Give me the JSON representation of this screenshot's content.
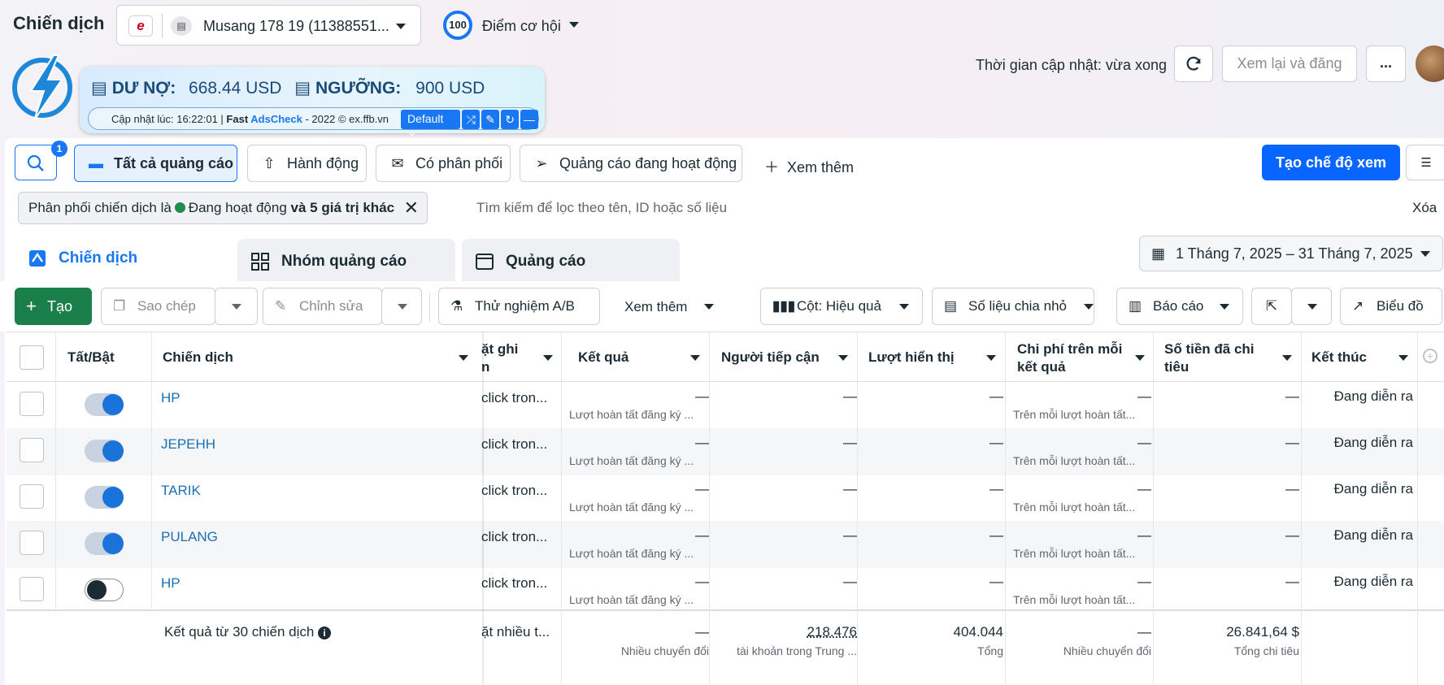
{
  "header": {
    "title": "Chiến dịch",
    "account_name": "Musang 178 19 (11388551...",
    "score": "100",
    "score_label": "Điểm cơ hội",
    "update_time": "Thời gian cập nhật: vừa xong",
    "review_button": "Xem lại và đăng",
    "more_button": "..."
  },
  "ext_panel": {
    "debt_label": "DƯ NỢ:",
    "debt_value": "668.44 USD",
    "limit_label": "NGƯỠNG:",
    "limit_value": "900 USD",
    "update_prefix": "Cập nhật lúc: 16:22:01 | ",
    "brand_fast": "Fast ",
    "brand_ads": "AdsCheck",
    "update_suffix": " - 2022 © ex.ffb.vn",
    "preset": "Default"
  },
  "filters": {
    "search_badge": "1",
    "all_ads": "Tất cả quảng cáo",
    "actions": "Hành động",
    "delivered": "Có phân phối",
    "active_ads": "Quảng cáo đang hoạt động",
    "see_more": "Xem thêm",
    "create_view": "Tạo chế độ xem",
    "chip_prefix": "Phân phối chiến dịch là",
    "chip_status": "Đang hoạt động",
    "chip_suffix": "và 5 giá trị khác",
    "search_placeholder": "Tìm kiếm để lọc theo tên, ID hoặc số liệu",
    "clear": "Xóa"
  },
  "tabs": {
    "campaigns": "Chiến dịch",
    "adsets": "Nhóm quảng cáo",
    "ads": "Quảng cáo",
    "date_range": "1 Tháng 7, 2025 – 31 Tháng 7, 2025"
  },
  "toolbar": {
    "create": "Tạo",
    "duplicate": "Sao chép",
    "edit": "Chỉnh sửa",
    "ab_test": "Thử nghiệm A/B",
    "more": "Xem thêm",
    "columns": "Cột: Hiệu quả",
    "breakdown": "Số liệu chia nhỏ",
    "reports": "Báo cáo",
    "chart": "Biểu đồ"
  },
  "table": {
    "headers": {
      "toggle": "Tất/Bật",
      "campaign": "Chiến dịch",
      "attribution_1": "ặt ghi",
      "attribution_2": "n",
      "results": "Kết quả",
      "reach": "Người tiếp cận",
      "impressions": "Lượt hiển thị",
      "cpr_1": "Chi phí trên mỗi",
      "cpr_2": "kết quả",
      "spend_1": "Số tiền đã chi",
      "spend_2": "tiêu",
      "ends": "Kết thúc"
    },
    "rows": [
      {
        "name": "HP",
        "on": true,
        "attr": "click tron...",
        "result": "—",
        "result_sub": "Lượt hoàn tất đăng ký ...",
        "reach": "—",
        "impr": "—",
        "cpr": "—",
        "cpr_sub": "Trên mỗi lượt hoàn tất...",
        "spend": "—",
        "ends": "Đang diễn ra"
      },
      {
        "name": "JEPEHH",
        "on": true,
        "attr": "click tron...",
        "result": "—",
        "result_sub": "Lượt hoàn tất đăng ký ...",
        "reach": "—",
        "impr": "—",
        "cpr": "—",
        "cpr_sub": "Trên mỗi lượt hoàn tất...",
        "spend": "—",
        "ends": "Đang diễn ra"
      },
      {
        "name": "TARIK",
        "on": true,
        "attr": "click tron...",
        "result": "—",
        "result_sub": "Lượt hoàn tất đăng ký ...",
        "reach": "—",
        "impr": "—",
        "cpr": "—",
        "cpr_sub": "Trên mỗi lượt hoàn tất...",
        "spend": "—",
        "ends": "Đang diễn ra"
      },
      {
        "name": "PULANG",
        "on": true,
        "attr": "click tron...",
        "result": "—",
        "result_sub": "Lượt hoàn tất đăng ký ...",
        "reach": "—",
        "impr": "—",
        "cpr": "—",
        "cpr_sub": "Trên mỗi lượt hoàn tất...",
        "spend": "—",
        "ends": "Đang diễn ra"
      },
      {
        "name": "HP",
        "on": false,
        "attr": "click tron...",
        "result": "—",
        "result_sub": "Lượt hoàn tất đăng ký ...",
        "reach": "—",
        "impr": "—",
        "cpr": "—",
        "cpr_sub": "Trên mỗi lượt hoàn tất...",
        "spend": "—",
        "ends": "Đang diễn ra"
      }
    ],
    "totals": {
      "label": "Kết quả từ 30 chiến dịch",
      "attr": "ặt nhiều t...",
      "result": "—",
      "result_sub": "Nhiều chuyển đổi",
      "reach": "218.476",
      "reach_sub": "tài khoản trong Trung ...",
      "impr": "404.044",
      "impr_sub": "Tổng",
      "cpr": "—",
      "cpr_sub": "Nhiều chuyển đổi",
      "spend": "26.841,64 $",
      "spend_sub": "Tổng chi tiêu"
    }
  }
}
